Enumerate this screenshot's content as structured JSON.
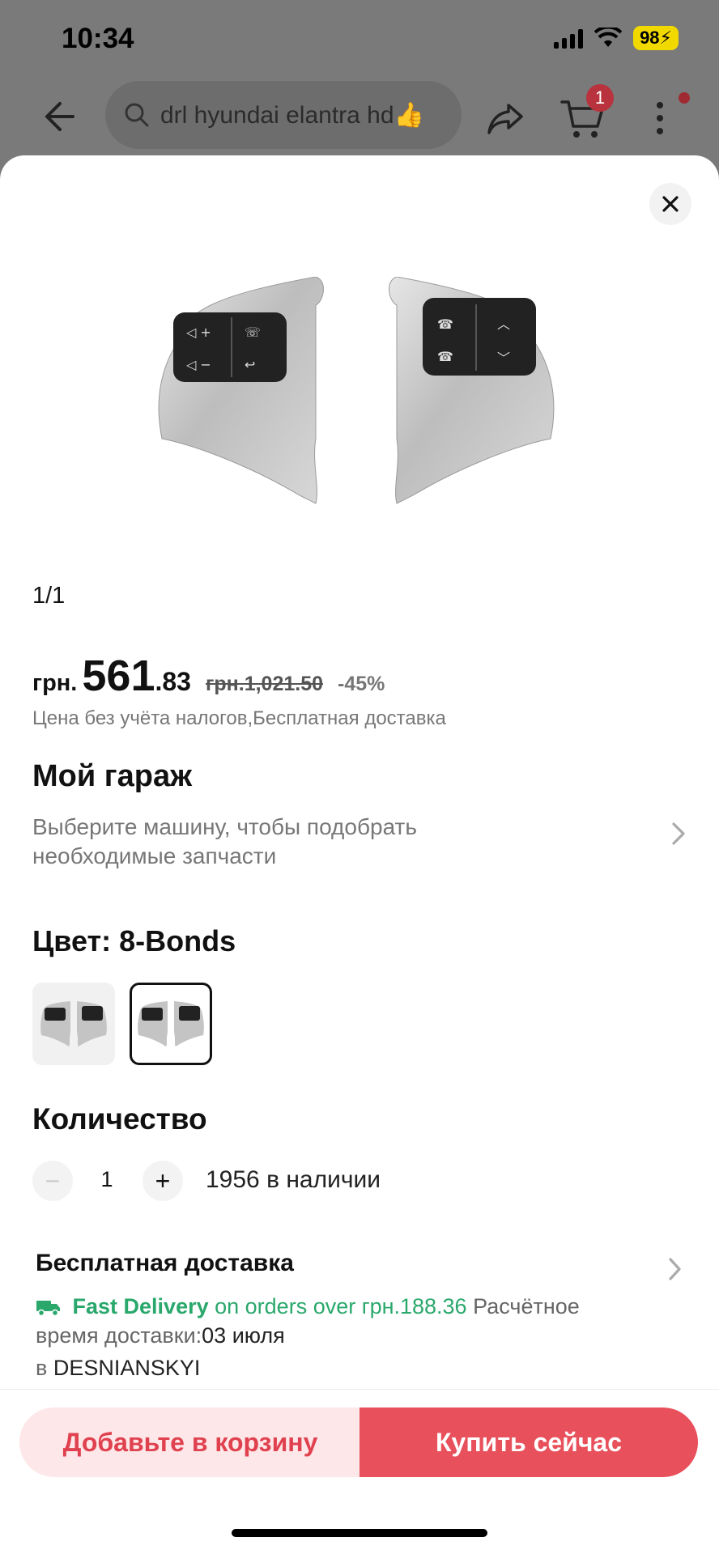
{
  "status_bar": {
    "time": "10:34",
    "battery": "98"
  },
  "search": {
    "query": "drl hyundai elantra hd👍"
  },
  "cart": {
    "badge_count": "1"
  },
  "gallery": {
    "counter": "1/1"
  },
  "price": {
    "currency": "грн.",
    "integer": "561",
    "decimal": ".83",
    "old_price": "грн.1,021.50",
    "discount": "-45%",
    "tax_note": "Цена без учёта налогов,Бесплатная доставка"
  },
  "garage": {
    "title": "Мой гараж",
    "subtitle": "Выберите машину, чтобы подобрать необходимые запчасти"
  },
  "color": {
    "label": "Цвет: 8-Bonds",
    "selected_index": 1,
    "swatch_count": 2
  },
  "quantity": {
    "title": "Количество",
    "minus": "−",
    "value": "1",
    "plus": "+",
    "stock": "1956 в наличии"
  },
  "shipping": {
    "title": "Бесплатная доставка",
    "fast_delivery": "Fast Delivery",
    "orders_over": "on orders over грн.188.36",
    "estimated": "Расчётное",
    "time_label": "время доставки:",
    "date": "03 июля",
    "from_prefix": "в",
    "from_location": "DESNIANSKYI"
  },
  "actions": {
    "add_to_cart": "Добавьте в корзину",
    "buy_now": "Купить сейчас"
  },
  "colors": {
    "accent_red": "#e8505b",
    "light_red": "#fde7e8",
    "green": "#2aa86c"
  }
}
